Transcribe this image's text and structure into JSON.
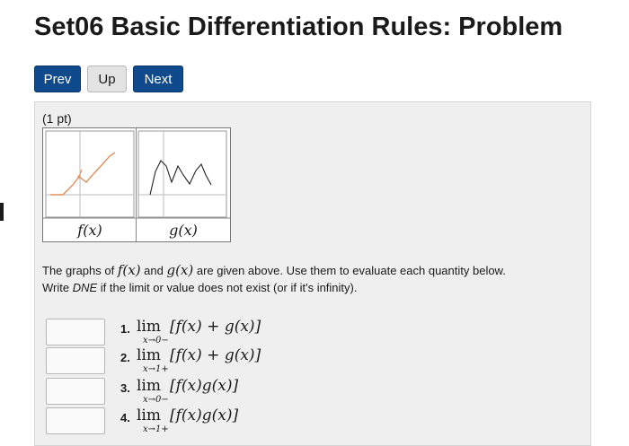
{
  "page": {
    "title": "Set06 Basic Differentiation Rules: Problem"
  },
  "nav": {
    "prev": "Prev",
    "up": "Up",
    "next": "Next"
  },
  "problem": {
    "points": "(1 pt)",
    "graph_captions": {
      "f": "f(x)",
      "g": "g(x)"
    },
    "instructions_line1_a": "The graphs of ",
    "instructions_f": "f(x)",
    "instructions_and": " and ",
    "instructions_g": "g(x)",
    "instructions_line1_b": " are given above. Use them to evaluate each quantity below.",
    "instructions_line2_a": "Write ",
    "instructions_dne": "DNE",
    "instructions_line2_b": " if the limit or value does not exist (or if it's infinity)."
  },
  "questions": [
    {
      "num": "1.",
      "lim": "lim",
      "sub": "x→0−",
      "expr": "[f(x) + g(x)]",
      "value": ""
    },
    {
      "num": "2.",
      "lim": "lim",
      "sub": "x→1+",
      "expr": "[f(x) + g(x)]",
      "value": ""
    },
    {
      "num": "3.",
      "lim": "lim",
      "sub": "x→0−",
      "expr": "[f(x)g(x)]",
      "value": ""
    },
    {
      "num": "4.",
      "lim": "lim",
      "sub": "x→1+",
      "expr": "[f(x)g(x)]",
      "value": ""
    }
  ],
  "colors": {
    "button_blue": "#0f4a8c",
    "curve_orange": "#e09060"
  }
}
